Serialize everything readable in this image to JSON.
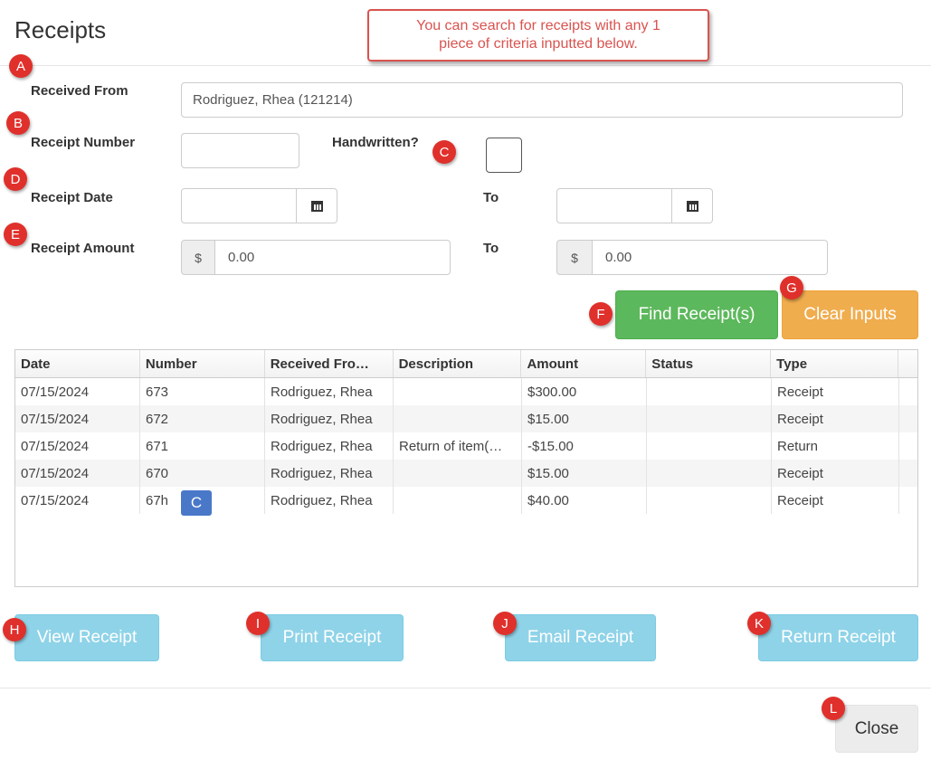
{
  "dialog": {
    "title": "Receipts"
  },
  "callout": {
    "line1": "You can search for receipts with any 1",
    "line2": "piece of criteria inputted below."
  },
  "form": {
    "received_from_label": "Received From",
    "received_from_value": "Rodriguez, Rhea (121214)",
    "receipt_number_label": "Receipt Number",
    "receipt_number_value": "",
    "handwritten_label": "Handwritten?",
    "handwritten_checked": false,
    "receipt_date_label": "Receipt Date",
    "date_from_value": "",
    "date_to_label": "To",
    "date_to_value": "",
    "receipt_amount_label": "Receipt Amount",
    "amount_from_currency": "$",
    "amount_from_value": "0.00",
    "amount_to_label": "To",
    "amount_to_currency": "$",
    "amount_to_value": "0.00"
  },
  "actions": {
    "find": "Find Receipt(s)",
    "clear": "Clear Inputs"
  },
  "grid": {
    "columns": [
      "Date",
      "Number",
      "Received Fro…",
      "Description",
      "Amount",
      "Status",
      "Type"
    ],
    "rows": [
      [
        "07/15/2024",
        "673",
        "Rodriguez, Rhea",
        "",
        "$300.00",
        "",
        "Receipt"
      ],
      [
        "07/15/2024",
        "672",
        "Rodriguez, Rhea",
        "",
        "$15.00",
        "",
        "Receipt"
      ],
      [
        "07/15/2024",
        "671",
        "Rodriguez, Rhea",
        "Return of item(…",
        "-$15.00",
        "",
        "Return"
      ],
      [
        "07/15/2024",
        "670",
        "Rodriguez, Rhea",
        "",
        "$15.00",
        "",
        "Receipt"
      ],
      [
        "07/15/2024",
        "67h",
        "Rodriguez, Rhea",
        "",
        "$40.00",
        "",
        "Receipt"
      ]
    ],
    "row_badge": "C"
  },
  "bottom_buttons": {
    "view": "View Receipt",
    "print": "Print Receipt",
    "email": "Email Receipt",
    "return": "Return Receipt"
  },
  "footer": {
    "close": "Close"
  },
  "markers": {
    "a": "A",
    "b": "B",
    "c": "C",
    "d": "D",
    "e": "E",
    "f": "F",
    "g": "G",
    "h": "H",
    "i": "I",
    "j": "J",
    "k": "K",
    "l": "L"
  },
  "colors": {
    "marker": "#e0302b",
    "success": "#5cb85c",
    "warning": "#f0ad4e",
    "info": "#8fd3e8",
    "callout_border": "#d9534f"
  },
  "icons": {
    "date_picker": "calendar-icon"
  }
}
